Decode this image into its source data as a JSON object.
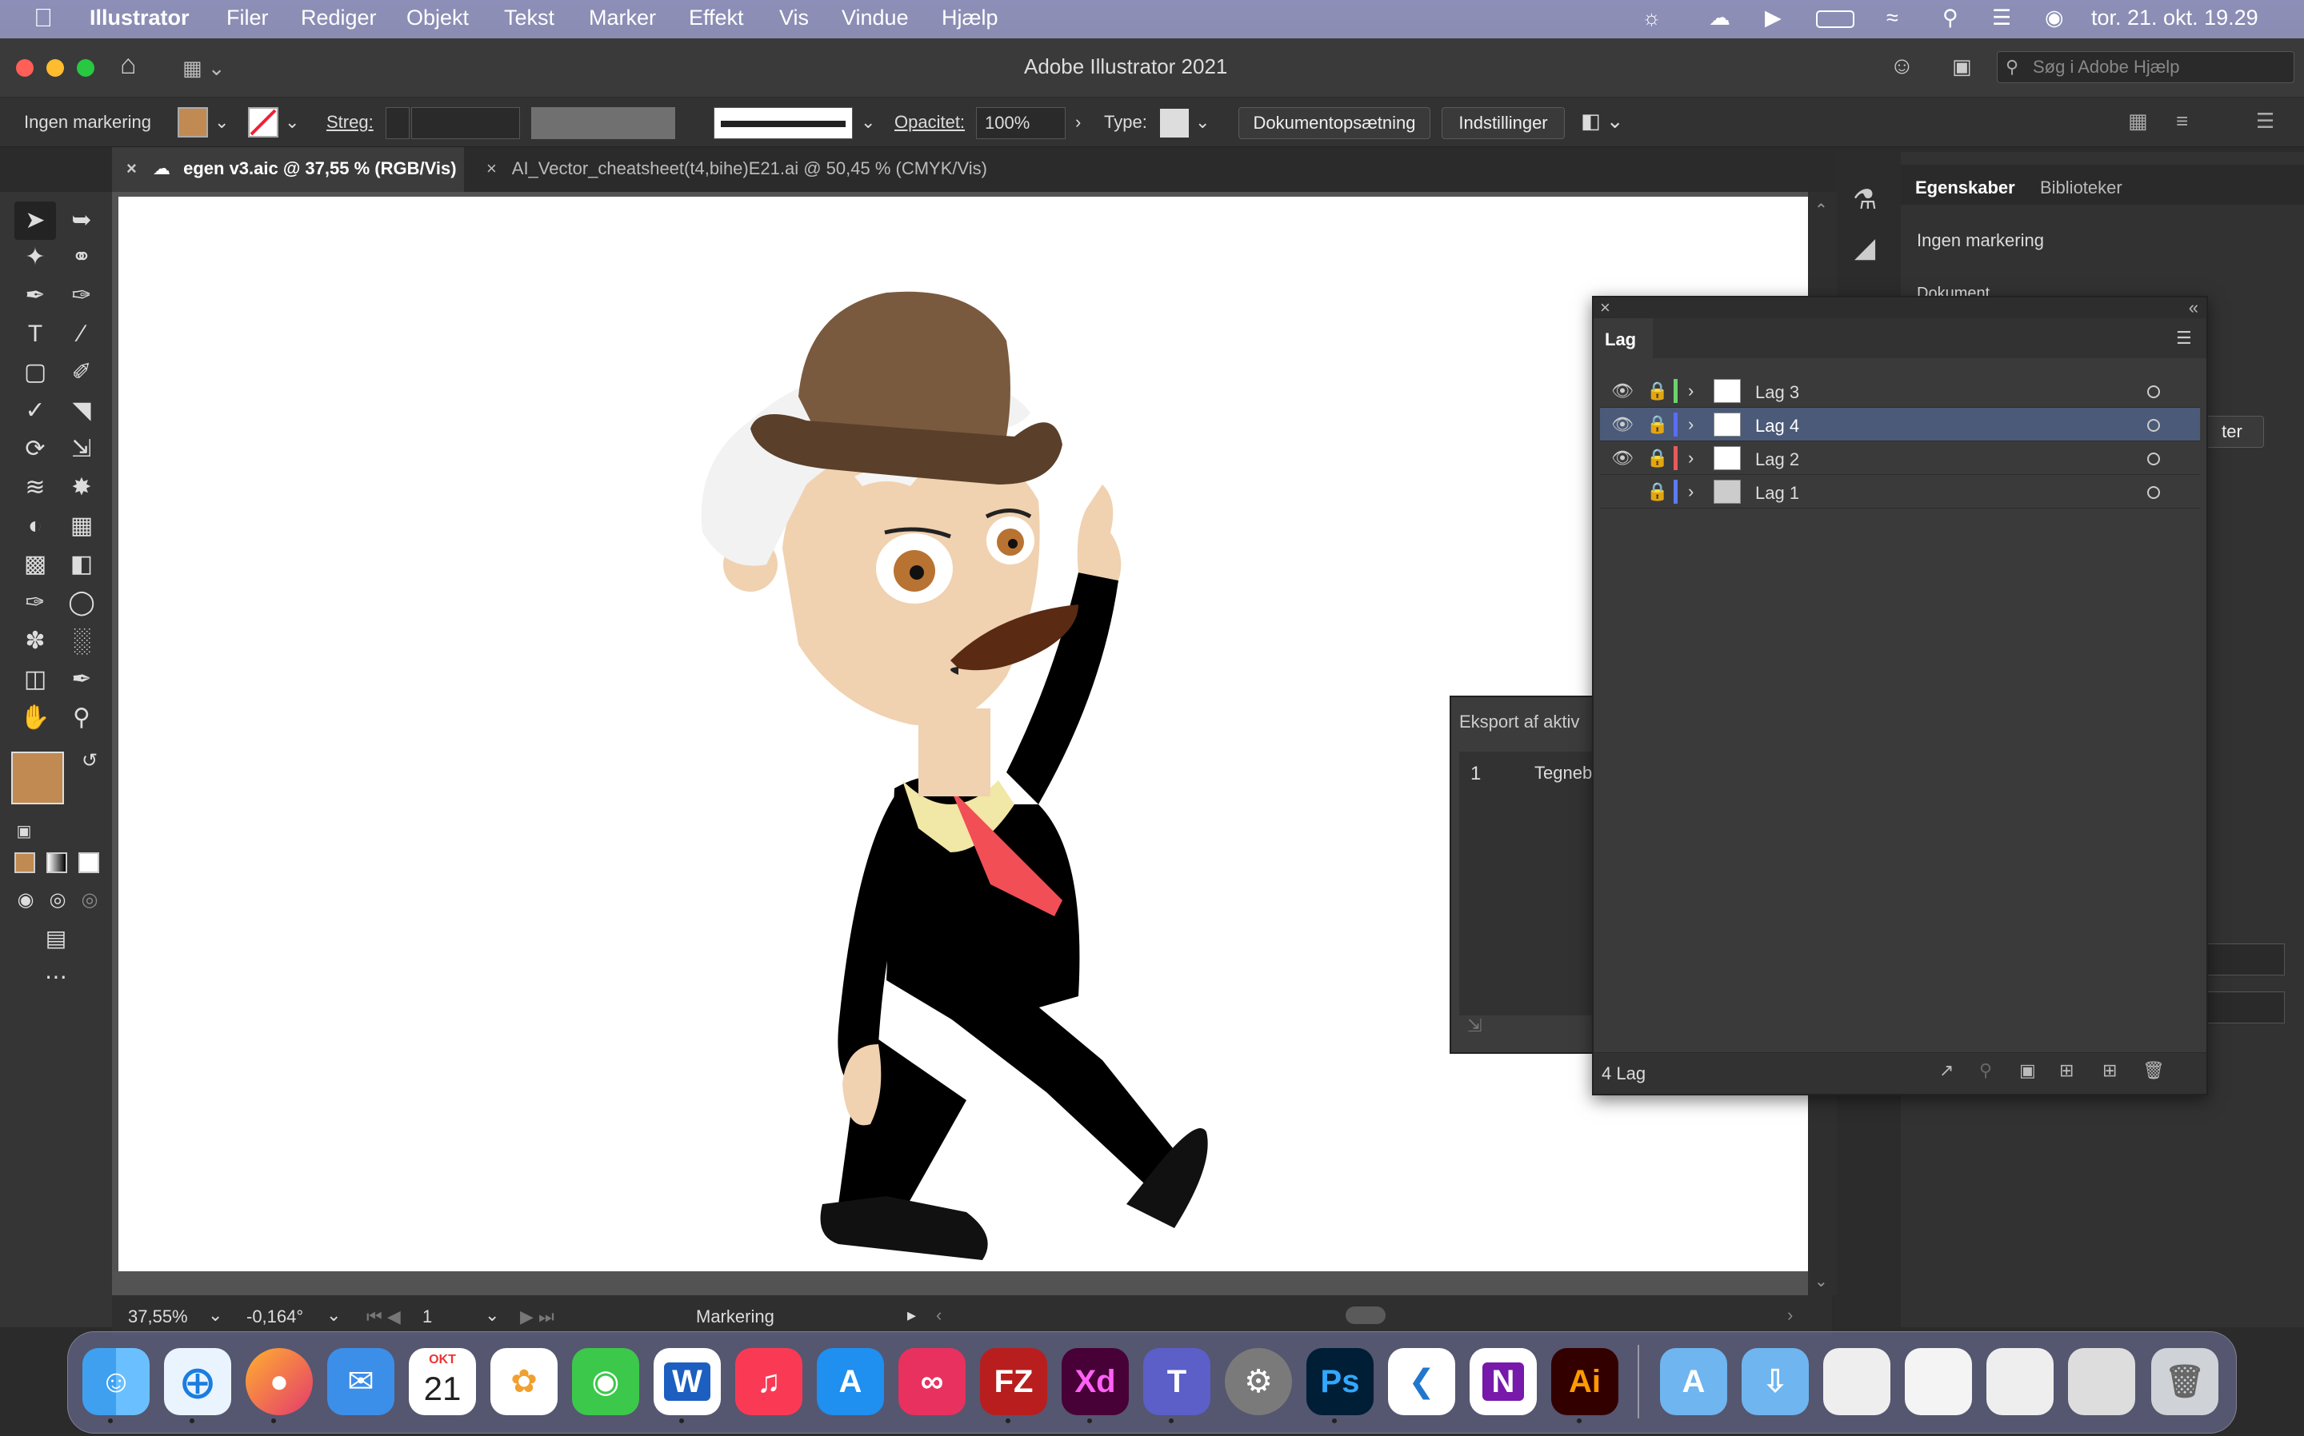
{
  "menubar": {
    "app_name": "Illustrator",
    "items": [
      "Filer",
      "Rediger",
      "Objekt",
      "Tekst",
      "Marker",
      "Effekt",
      "Vis",
      "Vindue",
      "Hjælp"
    ],
    "clock": "tor. 21. okt.  19.29"
  },
  "window": {
    "title": "Adobe Illustrator 2021",
    "search_placeholder": "Søg i Adobe Hjælp"
  },
  "controlbar": {
    "selection": "Ingen markering",
    "stroke_label": "Streg:",
    "opacity_label": "Opacitet:",
    "opacity_value": "100%",
    "type_label": "Type:",
    "doc_setup": "Dokumentopsætning",
    "settings": "Indstillinger"
  },
  "tabs": [
    {
      "label": "egen v3.aic @ 37,55 % (RGB/Vis)",
      "active": true
    },
    {
      "label": "AI_Vector_cheatsheet(t4,bihe)E21.ai @ 50,45 % (CMYK/Vis)",
      "active": false
    }
  ],
  "colors": {
    "fill": "#c08a52",
    "accent_selection": "#4a5a78",
    "menubar": "#8e8fb8"
  },
  "status": {
    "zoom": "37,55%",
    "rotation": "-0,164°",
    "artboard": "1",
    "mode": "Markering"
  },
  "properties": {
    "tab_properties": "Egenskaber",
    "tab_libraries": "Biblioteker",
    "selection": "Ingen markering",
    "section_document": "Dokument",
    "button_partial": "ter"
  },
  "layers_panel": {
    "title": "Lag",
    "count": "4 Lag",
    "layers": [
      {
        "name": "Lag 3",
        "visible": true,
        "color": "#6bd36b",
        "selected": false
      },
      {
        "name": "Lag 4",
        "visible": true,
        "color": "#5b6bff",
        "selected": true
      },
      {
        "name": "Lag 2",
        "visible": true,
        "color": "#e85a5a",
        "selected": false
      },
      {
        "name": "Lag 1",
        "visible": false,
        "color": "#5b7bff",
        "selected": false
      }
    ]
  },
  "export_panel": {
    "title": "Eksport af aktiv",
    "row_number": "1",
    "row_label": "Tegneb"
  },
  "dock": {
    "calendar_month": "OKT",
    "calendar_day": "21",
    "apps": [
      "Finder",
      "Safari",
      "Firefox",
      "Mail",
      "Kalender",
      "Fotos",
      "Beskeder",
      "Word",
      "Musik",
      "App Store",
      "Creative Cloud",
      "FileZilla",
      "Xd",
      "Teams",
      "Systemindstillinger",
      "Ps",
      "VS Code",
      "OneNote",
      "Ai"
    ],
    "labels": {
      "word": "W",
      "xd": "Xd",
      "ps": "Ps",
      "ai": "Ai",
      "fz": "FZ",
      "onenote": "N"
    }
  }
}
